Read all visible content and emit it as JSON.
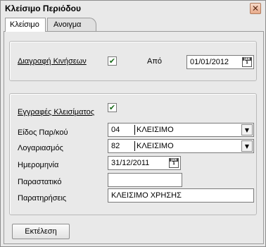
{
  "window": {
    "title": "Κλείσιμο Περιόδου",
    "close_glyph": "✕"
  },
  "tabs": [
    {
      "label": "Κλείσιμο",
      "active": true
    },
    {
      "label": "Ανοιγμα",
      "active": false
    }
  ],
  "delete_section": {
    "checkbox_label": "Διαγραφή Κινήσεων",
    "checked": true,
    "from_label": "Από",
    "from_value": "01/01/2012"
  },
  "closing_section": {
    "checkbox_label": "Εγγραφές Κλεισίματος",
    "checked": true,
    "doc_type_label": "Είδος Παρ/κού",
    "doc_type_code": "04",
    "doc_type_desc": "ΚΛΕΙΣΙΜΟ",
    "account_label": "Λογαριασμός",
    "account_code": "82",
    "account_desc": "ΚΛΕΙΣΙΜΟ",
    "date_label": "Ημερομηνία",
    "date_value": "31/12/2011",
    "document_label": "Παραστατικό",
    "document_value": "",
    "notes_label": "Παρατηρήσεις",
    "notes_value": "ΚΛΕΙΣΙΜΟ ΧΡΗΣΗΣ"
  },
  "actions": {
    "execute_label": "Εκτέλεση"
  },
  "icons": {
    "check_glyph": "✔",
    "dropdown_glyph": "▼",
    "calendar_icon": "calendar-icon",
    "calendar_top": "JAN",
    "calendar_day": "1"
  }
}
